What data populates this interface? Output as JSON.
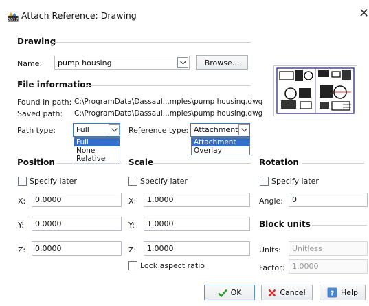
{
  "window": {
    "title": "Attach Reference: Drawing",
    "close_glyph": "✕",
    "icon": "drawing-reference-icon"
  },
  "drawing": {
    "section_title": "Drawing",
    "name_label": "Name:",
    "name_value": "pump housing",
    "browse_label": "Browse..."
  },
  "file_info": {
    "section_title": "File information",
    "found_label": "Found in path:",
    "found_value": "C:\\ProgramData\\Dassaul...mples\\pump housing.dwg",
    "saved_label": "Saved path:",
    "saved_value": "C:\\ProgramData\\Dassaul...mples\\pump housing.dwg",
    "path_type_label": "Path type:",
    "path_type_value": "Full",
    "path_type_options": [
      "Full",
      "None",
      "Relative"
    ],
    "reference_type_label": "Reference type:",
    "reference_type_value": "Attachment",
    "reference_type_options": [
      "Attachment",
      "Overlay"
    ]
  },
  "position": {
    "section_title": "Position",
    "specify_later": "Specify later",
    "x_label": "X:",
    "x_value": "0.0000",
    "y_label": "Y:",
    "y_value": "0.0000",
    "z_label": "Z:",
    "z_value": "0.0000"
  },
  "scale": {
    "section_title": "Scale",
    "specify_later": "Specify later",
    "x_label": "X:",
    "x_value": "1.0000",
    "y_label": "Y:",
    "y_value": "1.0000",
    "z_label": "Z:",
    "z_value": "1.0000",
    "lock_aspect": "Lock aspect ratio"
  },
  "rotation": {
    "section_title": "Rotation",
    "specify_later": "Specify later",
    "angle_label": "Angle:",
    "angle_value": "0"
  },
  "block_units": {
    "section_title": "Block units",
    "units_label": "Units:",
    "units_value": "Unitless",
    "factor_label": "Factor:",
    "factor_value": "1.0000"
  },
  "buttons": {
    "ok": "OK",
    "cancel": "Cancel",
    "help": "Help"
  },
  "colors": {
    "selection": "#3270cc",
    "ok_check": "#2a9d2a",
    "cancel_x": "#d42a2a",
    "help_icon": "#4a86cf"
  }
}
